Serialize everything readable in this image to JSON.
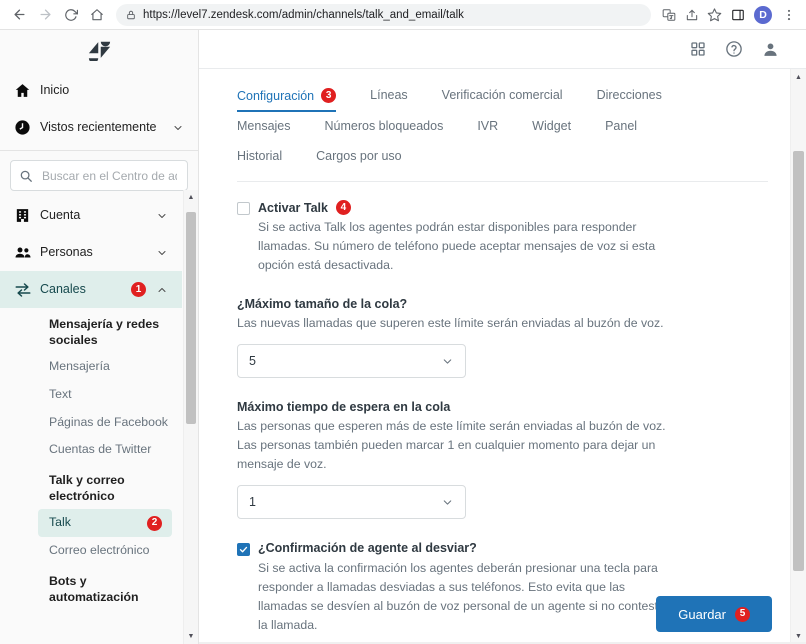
{
  "browser": {
    "url": "https://level7.zendesk.com/admin/channels/talk_and_email/talk",
    "back_icon": "back-arrow-icon",
    "forward_icon": "forward-arrow-icon",
    "reload_icon": "reload-icon",
    "home_icon": "home-icon",
    "lock_icon": "lock-icon",
    "translate_icon": "translate-icon",
    "share_icon": "share-icon",
    "bookmark_icon": "star-icon",
    "panel_icon": "side-panel-icon",
    "profile_initial": "D",
    "menu_icon": "three-dots-menu-icon"
  },
  "sidebar": {
    "logo": "zendesk-logo",
    "top_items": [
      {
        "label": "Inicio",
        "icon": "home-icon",
        "has_chevron": false
      },
      {
        "label": "Vistos recientemente",
        "icon": "clock-icon",
        "has_chevron": true
      }
    ],
    "search": {
      "placeholder": "Buscar en el Centro de administración",
      "value": "",
      "icon": "search-icon"
    },
    "nav_items": [
      {
        "label": "Cuenta",
        "icon": "building-icon",
        "badge": "",
        "active": false,
        "chevron": "down"
      },
      {
        "label": "Personas",
        "icon": "people-icon",
        "badge": "",
        "active": false,
        "chevron": "down"
      },
      {
        "label": "Canales",
        "icon": "channels-icon",
        "badge": "1",
        "active": true,
        "chevron": "up"
      }
    ],
    "groups": [
      {
        "heading": "Mensajería y redes sociales",
        "items": [
          {
            "label": "Mensajería",
            "selected": false,
            "badge": ""
          },
          {
            "label": "Text",
            "selected": false,
            "badge": ""
          },
          {
            "label": "Páginas de Facebook",
            "selected": false,
            "badge": ""
          },
          {
            "label": "Cuentas de Twitter",
            "selected": false,
            "badge": ""
          }
        ]
      },
      {
        "heading": "Talk y correo electrónico",
        "items": [
          {
            "label": "Talk",
            "selected": true,
            "badge": "2"
          },
          {
            "label": "Correo electrónico",
            "selected": false,
            "badge": ""
          }
        ]
      },
      {
        "heading": "Bots y automatización",
        "items": []
      }
    ]
  },
  "topbar": {
    "apps_icon": "grid-apps-icon",
    "help_icon": "help-circle-icon",
    "user_icon": "user-avatar-icon"
  },
  "tabs": {
    "row1": [
      {
        "label": "Configuración",
        "active": true,
        "badge": "3"
      },
      {
        "label": "Líneas",
        "active": false,
        "badge": ""
      },
      {
        "label": "Verificación comercial",
        "active": false,
        "badge": ""
      },
      {
        "label": "Direcciones",
        "active": false,
        "badge": ""
      }
    ],
    "row2": [
      {
        "label": "Mensajes",
        "active": false,
        "badge": ""
      },
      {
        "label": "Números bloqueados",
        "active": false,
        "badge": ""
      },
      {
        "label": "IVR",
        "active": false,
        "badge": ""
      },
      {
        "label": "Widget",
        "active": false,
        "badge": ""
      },
      {
        "label": "Panel",
        "active": false,
        "badge": ""
      }
    ],
    "row3": [
      {
        "label": "Historial",
        "active": false,
        "badge": ""
      },
      {
        "label": "Cargos por uso",
        "active": false,
        "badge": ""
      }
    ]
  },
  "form": {
    "activar_talk": {
      "title": "Activar Talk",
      "badge": "4",
      "checked": false,
      "help": "Si se activa Talk los agentes podrán estar disponibles para responder llamadas. Su número de teléfono puede aceptar mensajes de voz si esta opción está desactivada."
    },
    "queue_size": {
      "label": "¿Máximo tamaño de la cola?",
      "help": "Las nuevas llamadas que superen este límite serán enviadas al buzón de voz.",
      "value": "5",
      "chevron_icon": "chevron-down-icon"
    },
    "queue_wait": {
      "label": "Máximo tiempo de espera en la cola",
      "help": "Las personas que esperen más de este límite serán enviadas al buzón de voz. Las personas también pueden marcar 1 en cualquier momento para dejar un mensaje de voz.",
      "value": "1",
      "chevron_icon": "chevron-down-icon"
    },
    "agent_confirmation": {
      "title": "¿Confirmación de agente al desviar?",
      "checked": true,
      "help": "Si se activa la confirmación los agentes deberán presionar una tecla para responder a llamadas desviadas a sus teléfonos. Esto evita que las llamadas se desvíen al buzón de voz personal de un agente si no contesta la llamada."
    }
  },
  "footer": {
    "save_label": "Guardar",
    "save_badge": "5"
  },
  "colors": {
    "accent_blue": "#1f73b7",
    "badge_red": "#e02020",
    "active_nav_bg": "#dfeeeb",
    "sidebar_bg": "#fafafa"
  }
}
